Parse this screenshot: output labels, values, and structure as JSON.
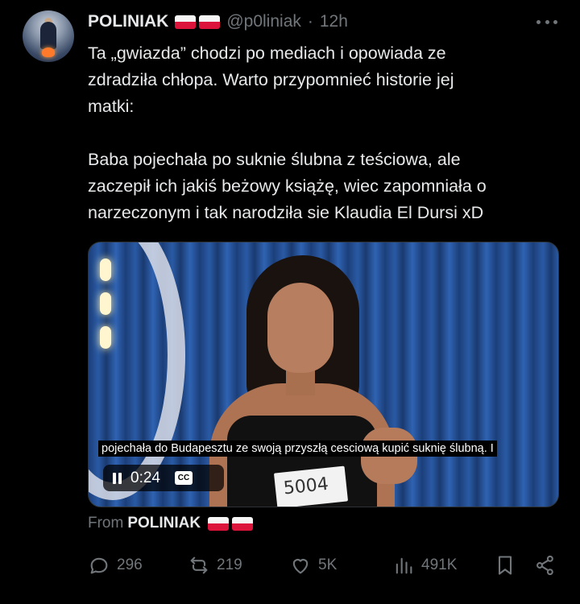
{
  "tweet": {
    "author_name": "POLINIAK",
    "handle": "@p0liniak",
    "separator": "·",
    "time": "12h",
    "text_lines_1": [
      "Ta „gwiazda” chodzi po mediach i opowiada ze",
      "zdradziła chłopa. Warto przypomnieć historie jej",
      "matki:"
    ],
    "text_lines_2": [
      "Baba pojechała po suknie ślubna z teściowa, ale",
      "zaczepił ich jakiś beżowy książę, wiec zapomniała o",
      "narzeczonym i tak narodziła sie Klaudia El Dursi xD"
    ]
  },
  "video": {
    "caption": "pojechała do Budapesztu ze swoją przyszłą cesciową kupić suknię ślubną. I",
    "time": "0:24",
    "cc_label": "CC",
    "number_tag": "5004"
  },
  "source": {
    "label": "From",
    "name": "POLINIAK"
  },
  "actions": {
    "replies": "296",
    "reposts": "219",
    "likes": "5K",
    "views": "491K"
  },
  "icons": {
    "flag": "poland-flag-icon",
    "more": "more-icon",
    "pause": "pause-icon",
    "cc": "closed-captions-icon",
    "reply": "reply-icon",
    "repost": "repost-icon",
    "like": "heart-icon",
    "views": "views-icon",
    "bookmark": "bookmark-icon",
    "share": "share-icon"
  },
  "colors": {
    "background": "#000000",
    "text": "#e7e9ea",
    "muted": "#71767b",
    "flag_red": "#dc143c"
  }
}
